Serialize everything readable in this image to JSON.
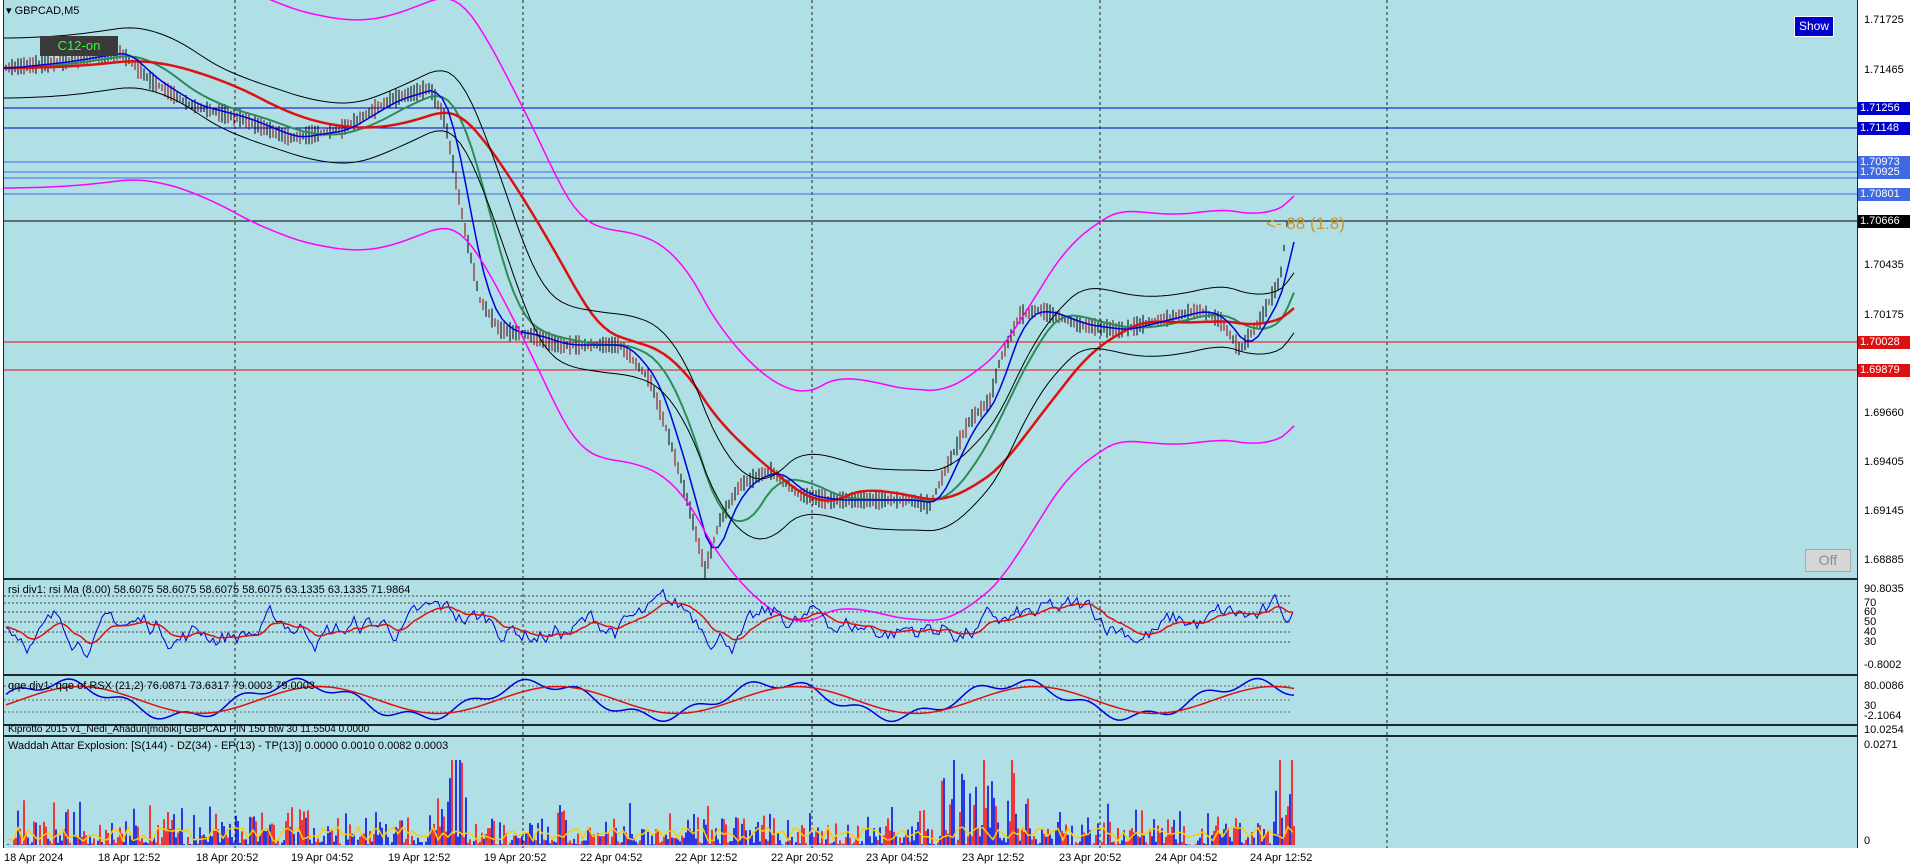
{
  "chart": {
    "symbol_title": "GBPCAD,M5",
    "tag_label": "C12-on",
    "show_button": "Show",
    "off_button": "Off",
    "annotation": "<- 88 (1.8)",
    "price_ticks": [
      "1.71725",
      "1.71465",
      "1.70435",
      "1.70175",
      "1.69660",
      "1.69405",
      "1.69145",
      "1.68885"
    ],
    "price_labels": [
      {
        "text": "1.71256",
        "color": "#0000cc"
      },
      {
        "text": "1.71148",
        "color": "#0000cc"
      },
      {
        "text": "1.70973",
        "color": "#4169e1"
      },
      {
        "text": "1.70925",
        "color": "#4169e1"
      },
      {
        "text": "1.70801",
        "color": "#4169e1"
      },
      {
        "text": "1.70666",
        "color": "#000000"
      },
      {
        "text": "1.70028",
        "color": "#dd1111"
      },
      {
        "text": "1.69879",
        "color": "#dd1111"
      }
    ],
    "time_labels": [
      "18 Apr 2024",
      "18 Apr 12:52",
      "18 Apr 20:52",
      "19 Apr 04:52",
      "19 Apr 12:52",
      "19 Apr 20:52",
      "22 Apr 04:52",
      "22 Apr 12:52",
      "22 Apr 20:52",
      "23 Apr 04:52",
      "23 Apr 12:52",
      "23 Apr 20:52",
      "24 Apr 04:52",
      "24 Apr 12:52"
    ]
  },
  "rsi": {
    "title": "rsi div1: rsi Ma (8.00) 58.6075 58.6075 58.6075 58.6075 63.1335 63.1335 71.9864",
    "ticks": [
      "90.8035",
      "70",
      "60",
      "50",
      "40",
      "30",
      "-0.8002"
    ]
  },
  "qqe": {
    "title": "qqe div1: qqe of RSX (21,2) 76.0871 73.6317 79.0003 79.0003",
    "ticks": [
      "80.0086",
      "30",
      "-2.1064"
    ]
  },
  "kip": {
    "title": "Kiprotto 2015 v1_Nedi_Ahadun[mobiki] GBPCAD PIN 150 btw 30 11.5504 0.0000",
    "ticks": [
      "10.0254"
    ]
  },
  "wae": {
    "title": "Waddah Attar Explosion: [S(144) - DZ(34) - EP(13) - TP(13)] 0.0000 0.0010 0.0082 0.0003",
    "ticks": [
      "0.0271",
      "0"
    ]
  },
  "colors": {
    "background": "#b0e0e6",
    "ema_red": "#dd1111",
    "ema_green": "#2e8b57",
    "bands": "#ff00ff",
    "rsi_blue": "#0000dd",
    "rsi_red": "#dd1111",
    "wae_blue": "#0000dd",
    "wae_red": "#ff0000",
    "wae_yellow": "#ffcc00"
  }
}
